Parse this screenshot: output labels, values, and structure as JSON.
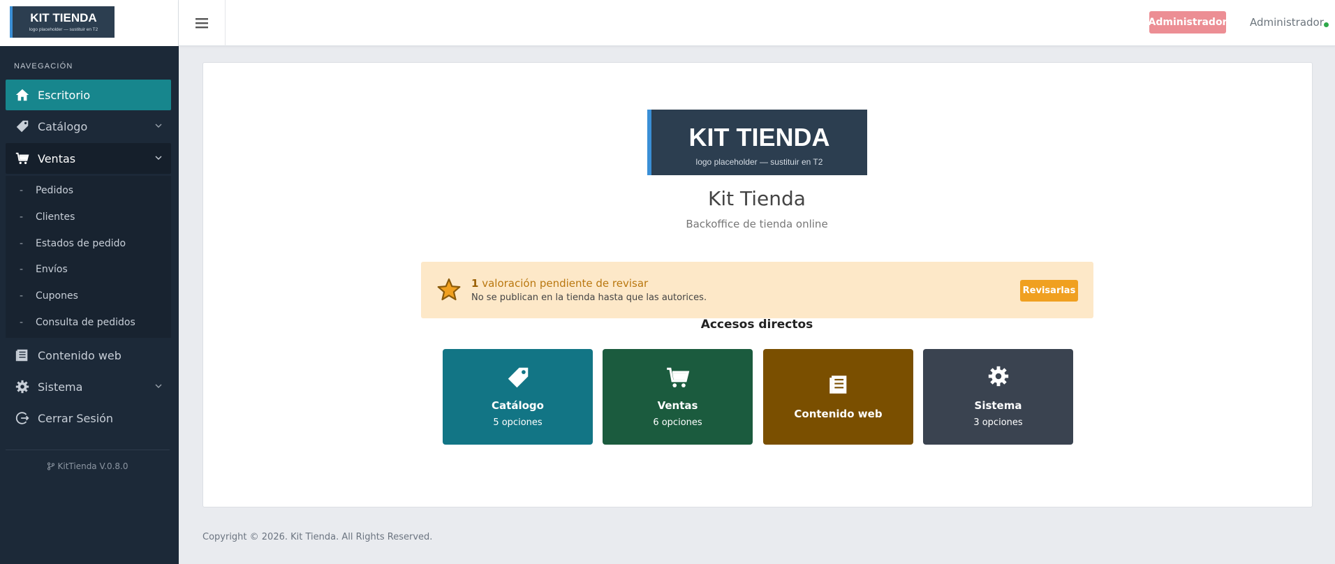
{
  "brand": {
    "logo_title": "KIT TIENDA",
    "logo_subtitle": "logo placeholder — sustituir en T2",
    "colors": {
      "logo_bg": "#2c3e50",
      "logo_accent": "#3a8fd6",
      "sidebar_bg": "#1c2938",
      "active": "#17868d"
    }
  },
  "sidebar": {
    "heading": "NAVEGACIÓN",
    "items": [
      {
        "label": "Escritorio",
        "icon": "home-icon",
        "state": "active"
      },
      {
        "label": "Catálogo",
        "icon": "tag-icon",
        "state": "collapsed"
      },
      {
        "label": "Ventas",
        "icon": "cart-icon",
        "state": "expanded"
      },
      {
        "label": "Contenido web",
        "icon": "document-icon",
        "state": "none"
      },
      {
        "label": "Sistema",
        "icon": "gear-icon",
        "state": "collapsed"
      },
      {
        "label": "Cerrar Sesión",
        "icon": "logout-icon",
        "state": "none"
      }
    ],
    "ventas_sub": [
      {
        "label": "Pedidos"
      },
      {
        "label": "Clientes"
      },
      {
        "label": "Estados de pedido"
      },
      {
        "label": "Envíos"
      },
      {
        "label": "Cupones"
      },
      {
        "label": "Consulta de pedidos"
      }
    ],
    "version": "KitTienda V.0.8.0"
  },
  "topbar": {
    "role_badge": "Administrador",
    "user_name": "Administrador",
    "role_badge_color": "#ec8e94",
    "status_color": "#2ea84a"
  },
  "main": {
    "shop_name": "Kit Tienda",
    "shop_subtitle": "Backoffice de tienda online",
    "alert": {
      "count": "1",
      "message": " valoración pendiente de revisar",
      "note": "No se publican en la tienda hasta que las autorices.",
      "button": "Revisarlas",
      "bg": "#fde8c8"
    },
    "quick_title": "Accesos directos",
    "tiles": [
      {
        "label": "Catálogo",
        "sub": "5 opciones",
        "icon": "tag-icon",
        "color": "#127585"
      },
      {
        "label": "Ventas",
        "sub": "6 opciones",
        "icon": "cart-icon",
        "color": "#1b5b3e"
      },
      {
        "label": "Contenido web",
        "sub": "",
        "icon": "document-icon",
        "color": "#7a4f00"
      },
      {
        "label": "Sistema",
        "sub": "3 opciones",
        "icon": "gear-icon",
        "color": "#3a4350"
      }
    ]
  },
  "footer": {
    "copyright": "Copyright © 2026. Kit Tienda. All Rights Reserved."
  }
}
